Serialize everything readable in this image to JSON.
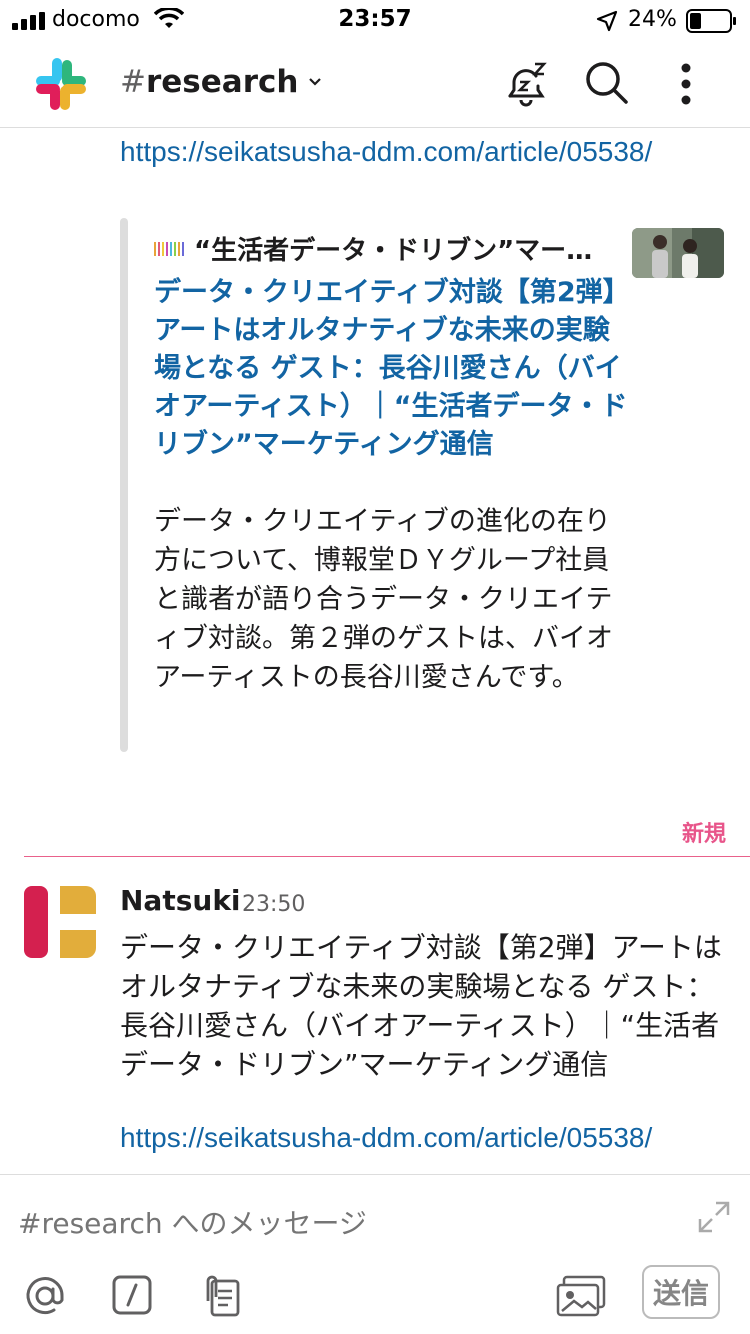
{
  "status_bar": {
    "carrier": "docomo",
    "time": "23:57",
    "battery_pct": "24%"
  },
  "header": {
    "channel_hash": "#",
    "channel_name": "research"
  },
  "messages": {
    "prev_link": "https://seikatsusha-ddm.com/article/05538/",
    "unfurl": {
      "site_name": "“生活者データ・ドリブン”マーケティング通信",
      "title": "データ・クリエイティブ対談【第2弾】アートはオルタナティブな未来の実験場となる ゲスト：長谷川愛さん（バイオアーティスト）｜“生活者データ・ドリブン”マーケティング通信",
      "description": "データ・クリエイティブの進化の在り方について、博報堂ＤＹグループ社員と識者が語り合うデータ・クリエイティブ対談。第２弾のゲストは、バイオアーティストの長谷川愛さんです。"
    },
    "new_label": "新規",
    "latest": {
      "author": "Natsuki",
      "time": "23:50",
      "text": "データ・クリエイティブ対談【第2弾】アートはオルタナティブな未来の実験場となる ゲスト：長谷川愛さん（バイオアーティスト）｜“生活者データ・ドリブン”マーケティング通信",
      "link": "https://seikatsusha-ddm.com/article/05538/"
    }
  },
  "composer": {
    "placeholder": "#research へのメッセージ",
    "send_label": "送信"
  },
  "colors": {
    "link": "#1264a3",
    "new_divider": "#e01e5a",
    "avatar_red": "#d4204f",
    "avatar_yellow": "#e2ad3b"
  }
}
